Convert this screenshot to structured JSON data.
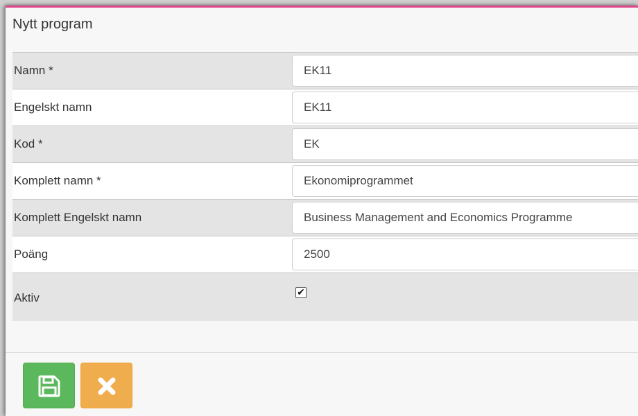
{
  "dialog": {
    "title": "Nytt program"
  },
  "form": {
    "fields": [
      {
        "label": "Namn *",
        "value": "EK11"
      },
      {
        "label": "Engelskt namn",
        "value": "EK11"
      },
      {
        "label": "Kod *",
        "value": "EK"
      },
      {
        "label": "Komplett namn *",
        "value": "Ekonomiprogrammet"
      },
      {
        "label": "Komplett Engelskt namn",
        "value": "Business Management and Economics Programme"
      },
      {
        "label": "Poäng",
        "value": "2500"
      }
    ],
    "active": {
      "label": "Aktiv",
      "checked": true,
      "check_glyph": "✔"
    }
  },
  "buttons": {
    "save": {
      "icon": "save-icon",
      "color": "#5cb85c"
    },
    "cancel": {
      "icon": "close-icon",
      "color": "#f0ad4e"
    }
  },
  "colors": {
    "accent_top_border": "#e0468a"
  }
}
